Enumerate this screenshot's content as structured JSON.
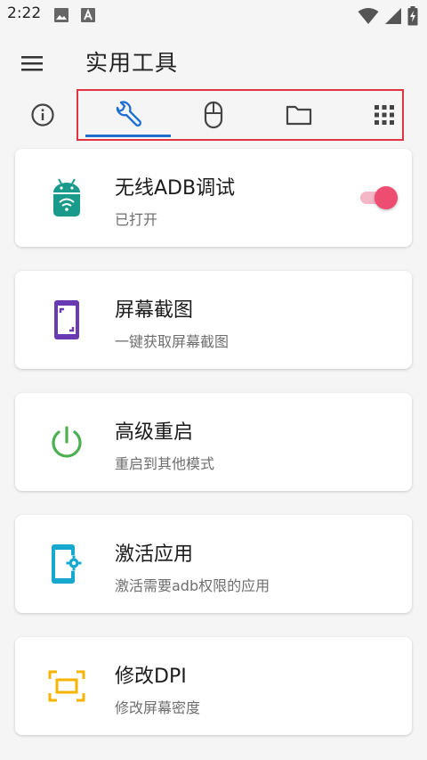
{
  "status_bar": {
    "time": "2:22",
    "icons_left": [
      "image-icon",
      "a-letter-icon"
    ],
    "icons_right": [
      "wifi-icon",
      "signal-icon",
      "battery-charging-icon"
    ]
  },
  "appbar": {
    "title": "实用工具",
    "menu_icon": "menu-icon"
  },
  "tabs": [
    {
      "icon": "info-icon",
      "selected": false
    },
    {
      "icon": "wrench-icon",
      "selected": true
    },
    {
      "icon": "mouse-icon",
      "selected": false
    },
    {
      "icon": "folder-icon",
      "selected": false
    },
    {
      "icon": "grid-icon",
      "selected": false
    }
  ],
  "colors": {
    "accent": "#1e6fd0",
    "highlight_border": "#e0343e",
    "switch_on": "#ee4d72",
    "adb_icon": "#1a9a8a",
    "screenshot_icon": "#6a3ab2",
    "reboot_icon": "#4caf50",
    "activate_icon": "#17a8cf",
    "dpi_icon": "#f5b400"
  },
  "cards": [
    {
      "title": "无线ADB调试",
      "subtitle": "已打开",
      "icon": "android-wifi-icon",
      "switch_on": true
    },
    {
      "title": "屏幕截图",
      "subtitle": "一键获取屏幕截图",
      "icon": "screenshot-icon"
    },
    {
      "title": "高级重启",
      "subtitle": "重启到其他模式",
      "icon": "power-icon"
    },
    {
      "title": "激活应用",
      "subtitle": "激活需要adb权限的应用",
      "icon": "phone-settings-icon"
    },
    {
      "title": "修改DPI",
      "subtitle": "修改屏幕密度",
      "icon": "screen-resize-icon"
    }
  ]
}
